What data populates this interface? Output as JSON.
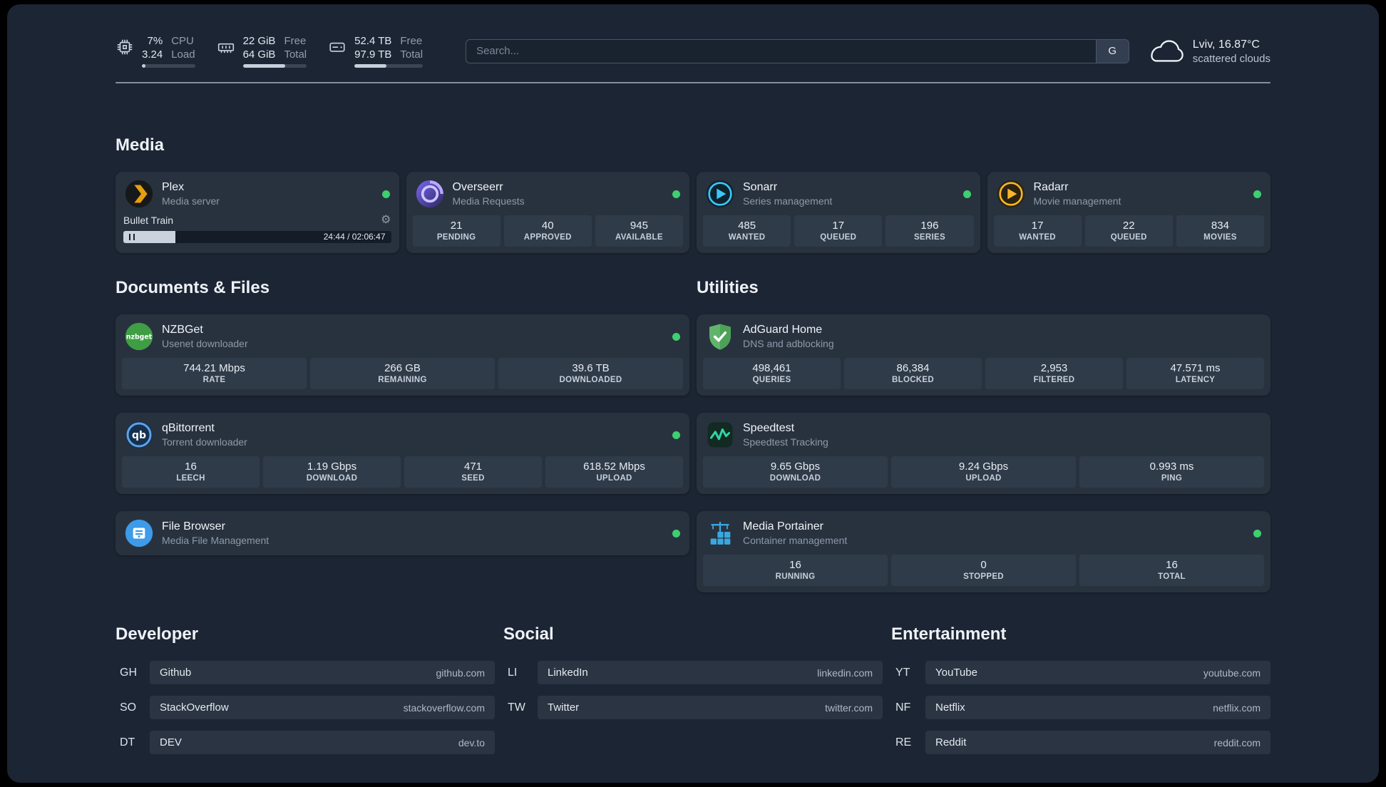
{
  "topbar": {
    "cpu": {
      "value1": "7%",
      "value2": "3.24",
      "label1": "CPU",
      "label2": "Load",
      "percent": 7
    },
    "memory": {
      "value1": "22 GiB",
      "value2": "64 GiB",
      "label1": "Free",
      "label2": "Total",
      "percent": 66
    },
    "disk": {
      "value1": "52.4 TB",
      "value2": "97.9 TB",
      "label1": "Free",
      "label2": "Total",
      "percent": 47
    },
    "search": {
      "placeholder": "Search...",
      "button_label": "G"
    },
    "weather": {
      "location": "Lviv, 16.87°C",
      "condition": "scattered clouds"
    }
  },
  "sections": {
    "media": "Media",
    "documents": "Documents & Files",
    "utilities": "Utilities",
    "developer": "Developer",
    "social": "Social",
    "entertainment": "Entertainment"
  },
  "services": {
    "plex": {
      "name": "Plex",
      "desc": "Media server",
      "now_playing": "Bullet Train",
      "time": "24:44 / 02:06:47",
      "progress_percent": 19.5
    },
    "overseerr": {
      "name": "Overseerr",
      "desc": "Media Requests",
      "stats": [
        {
          "value": "21",
          "label": "PENDING"
        },
        {
          "value": "40",
          "label": "APPROVED"
        },
        {
          "value": "945",
          "label": "AVAILABLE"
        }
      ]
    },
    "sonarr": {
      "name": "Sonarr",
      "desc": "Series management",
      "stats": [
        {
          "value": "485",
          "label": "WANTED"
        },
        {
          "value": "17",
          "label": "QUEUED"
        },
        {
          "value": "196",
          "label": "SERIES"
        }
      ]
    },
    "radarr": {
      "name": "Radarr",
      "desc": "Movie management",
      "stats": [
        {
          "value": "17",
          "label": "WANTED"
        },
        {
          "value": "22",
          "label": "QUEUED"
        },
        {
          "value": "834",
          "label": "MOVIES"
        }
      ]
    },
    "nzbget": {
      "name": "NZBGet",
      "desc": "Usenet downloader",
      "stats": [
        {
          "value": "744.21 Mbps",
          "label": "RATE"
        },
        {
          "value": "266 GB",
          "label": "REMAINING"
        },
        {
          "value": "39.6 TB",
          "label": "DOWNLOADED"
        }
      ]
    },
    "qbittorrent": {
      "name": "qBittorrent",
      "desc": "Torrent downloader",
      "stats": [
        {
          "value": "16",
          "label": "LEECH"
        },
        {
          "value": "1.19 Gbps",
          "label": "DOWNLOAD"
        },
        {
          "value": "471",
          "label": "SEED"
        },
        {
          "value": "618.52 Mbps",
          "label": "UPLOAD"
        }
      ]
    },
    "filebrowser": {
      "name": "File Browser",
      "desc": "Media File Management"
    },
    "adguard": {
      "name": "AdGuard Home",
      "desc": "DNS and adblocking",
      "stats": [
        {
          "value": "498,461",
          "label": "QUERIES"
        },
        {
          "value": "86,384",
          "label": "BLOCKED"
        },
        {
          "value": "2,953",
          "label": "FILTERED"
        },
        {
          "value": "47.571 ms",
          "label": "LATENCY"
        }
      ]
    },
    "speedtest": {
      "name": "Speedtest",
      "desc": "Speedtest Tracking",
      "stats": [
        {
          "value": "9.65 Gbps",
          "label": "DOWNLOAD"
        },
        {
          "value": "9.24 Gbps",
          "label": "UPLOAD"
        },
        {
          "value": "0.993 ms",
          "label": "PING"
        }
      ]
    },
    "portainer": {
      "name": "Media Portainer",
      "desc": "Container management",
      "stats": [
        {
          "value": "16",
          "label": "RUNNING"
        },
        {
          "value": "0",
          "label": "STOPPED"
        },
        {
          "value": "16",
          "label": "TOTAL"
        }
      ]
    }
  },
  "bookmarks": {
    "developer": [
      {
        "abbr": "GH",
        "name": "Github",
        "url": "github.com"
      },
      {
        "abbr": "SO",
        "name": "StackOverflow",
        "url": "stackoverflow.com"
      },
      {
        "abbr": "DT",
        "name": "DEV",
        "url": "dev.to"
      }
    ],
    "social": [
      {
        "abbr": "LI",
        "name": "LinkedIn",
        "url": "linkedin.com"
      },
      {
        "abbr": "TW",
        "name": "Twitter",
        "url": "twitter.com"
      }
    ],
    "entertainment": [
      {
        "abbr": "YT",
        "name": "YouTube",
        "url": "youtube.com"
      },
      {
        "abbr": "NF",
        "name": "Netflix",
        "url": "netflix.com"
      },
      {
        "abbr": "RE",
        "name": "Reddit",
        "url": "reddit.com"
      }
    ]
  },
  "colors": {
    "status_ok": "#3ecf6e",
    "page_bg": "#1c2534",
    "card_bg": "#28323f",
    "plex_accent": "#e5a00d"
  }
}
